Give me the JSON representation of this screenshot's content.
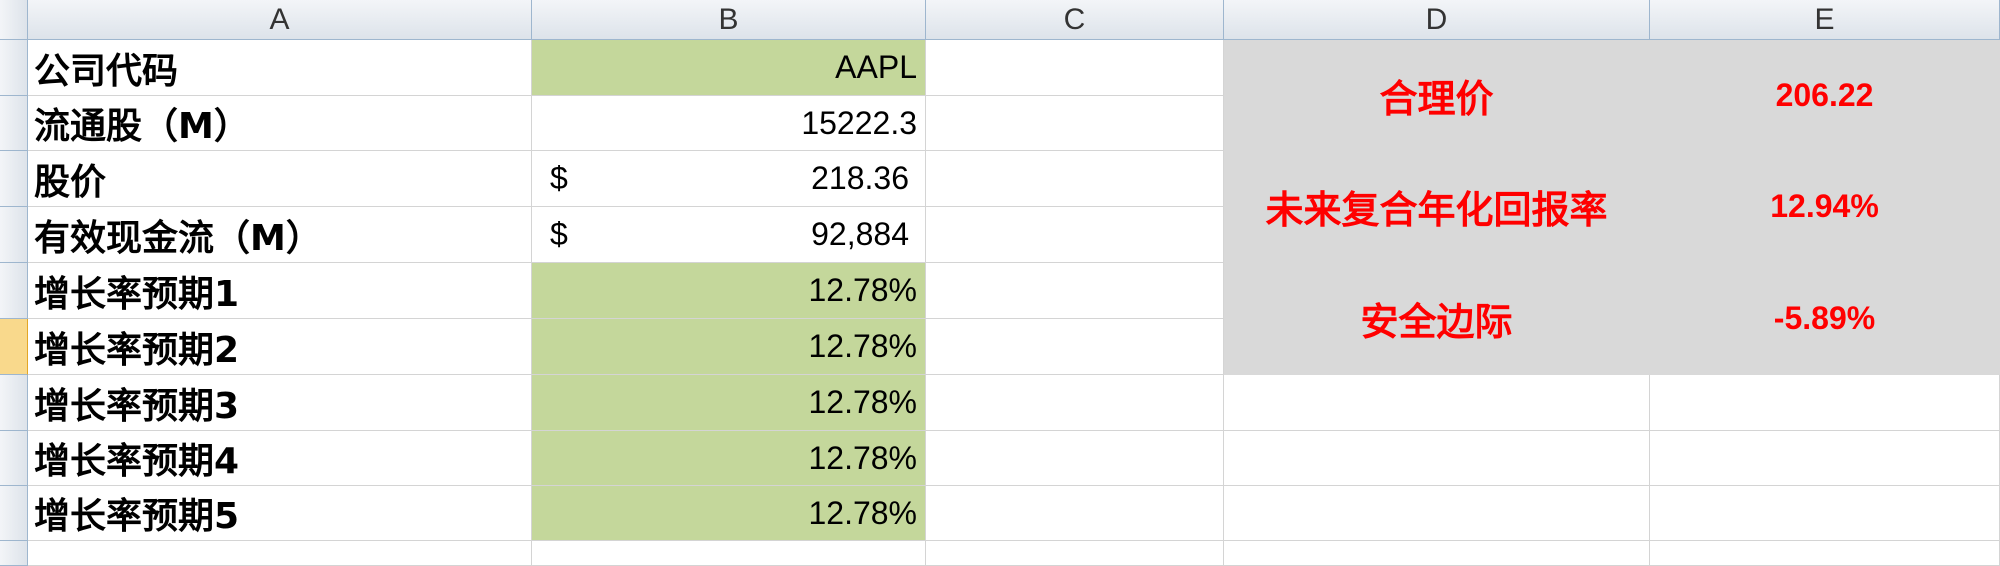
{
  "columns": [
    "A",
    "B",
    "C",
    "D",
    "E"
  ],
  "rows": [
    {
      "label": "公司代码",
      "value": "AAPL",
      "currency": ""
    },
    {
      "label": "流通股（M）",
      "value": "15222.3",
      "currency": ""
    },
    {
      "label": "股价",
      "value": "218.36",
      "currency": "$"
    },
    {
      "label": "有效现金流（M）",
      "value": "92,884",
      "currency": "$"
    },
    {
      "label": "增长率预期1",
      "value": "12.78%",
      "currency": ""
    },
    {
      "label": "增长率预期2",
      "value": "12.78%",
      "currency": ""
    },
    {
      "label": "增长率预期3",
      "value": "12.78%",
      "currency": ""
    },
    {
      "label": "增长率预期4",
      "value": "12.78%",
      "currency": ""
    },
    {
      "label": "增长率预期5",
      "value": "12.78%",
      "currency": ""
    }
  ],
  "summary": [
    {
      "label": "合理价",
      "value": "206.22"
    },
    {
      "label": "未来复合年化回报率",
      "value": "12.94%"
    },
    {
      "label": "安全边际",
      "value": "-5.89%"
    }
  ],
  "colors": {
    "input_fill": "#c4d79b",
    "summary_fill": "#d9d9d9",
    "summary_text": "#ff0000",
    "selected_row_header": "#f9d98c"
  }
}
